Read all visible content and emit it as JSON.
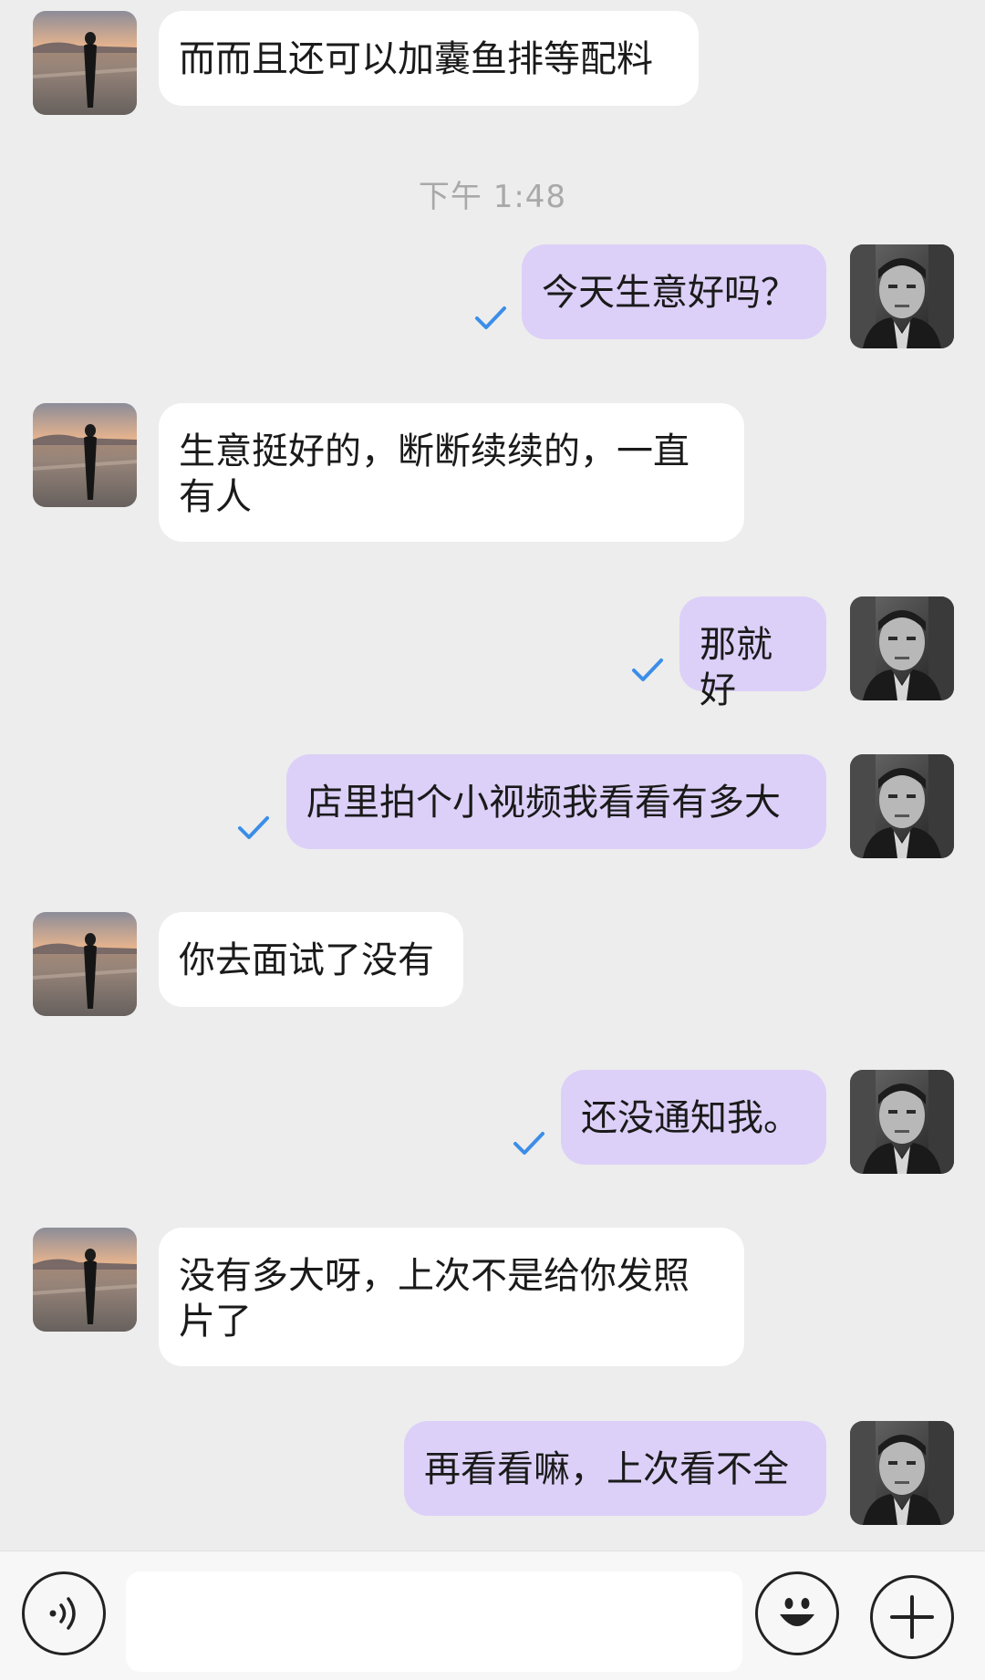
{
  "chat": {
    "timestamp": "下午 1:48",
    "messages": [
      {
        "side": "left",
        "text": "而而且还可以加囊鱼排等配料"
      },
      {
        "side": "right",
        "text": "今天生意好吗？",
        "read": true
      },
      {
        "side": "left",
        "text": "生意挺好的，断断续续的，一直有人"
      },
      {
        "side": "right",
        "text": "那就好",
        "read": true
      },
      {
        "side": "right",
        "text": "店里拍个小视频我看看有多大",
        "read": true
      },
      {
        "side": "left",
        "text": "你去面试了没有"
      },
      {
        "side": "right",
        "text": "还没通知我。",
        "read": true
      },
      {
        "side": "left",
        "text": "没有多大呀，上次不是给你发照片了"
      },
      {
        "side": "right",
        "text": "再看看嘛，上次看不全"
      }
    ]
  },
  "input_bar": {
    "icons": [
      "voice-icon",
      "emoji-icon",
      "plus-icon"
    ],
    "text_value": ""
  },
  "colors": {
    "background": "#ededed",
    "left_bubble": "#ffffff",
    "right_bubble": "#dcd0f8",
    "read_check": "#3b8ee8"
  }
}
